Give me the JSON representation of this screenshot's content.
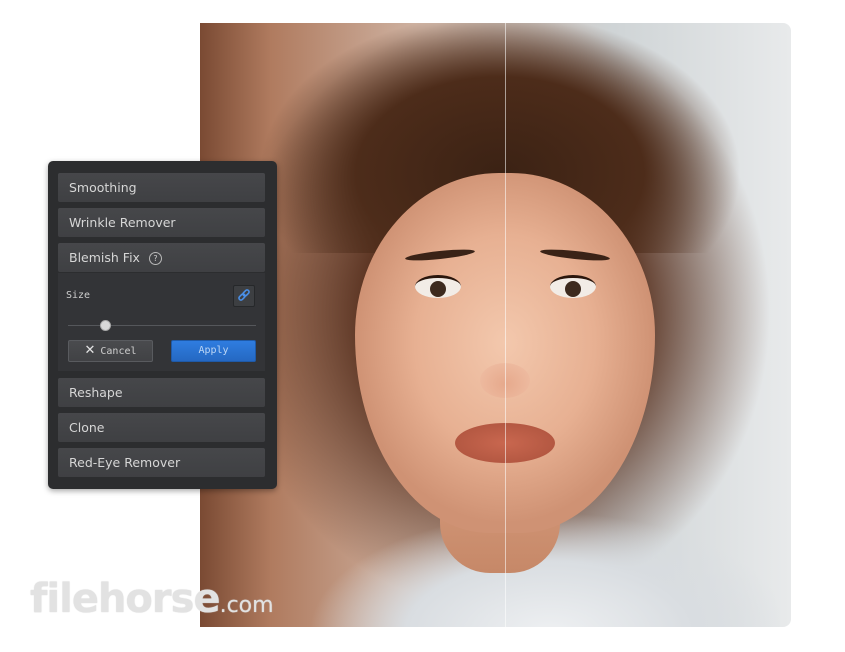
{
  "tools": {
    "smoothing": "Smoothing",
    "wrinkle_remover": "Wrinkle Remover",
    "blemish_fix": "Blemish Fix",
    "help_glyph": "?",
    "reshape": "Reshape",
    "clone": "Clone",
    "red_eye_remover": "Red-Eye Remover"
  },
  "blemish_panel": {
    "size_label": "Size",
    "size_value": 0.2,
    "cancel_label": "Cancel",
    "apply_label": "Apply",
    "cancel_icon": "close-icon",
    "link_icon": "link-icon"
  },
  "watermark": {
    "brand": "filehorse",
    "suffix": ".com"
  },
  "colors": {
    "accent": "#2f7de0",
    "panel_bg": "#2c2d2f"
  }
}
